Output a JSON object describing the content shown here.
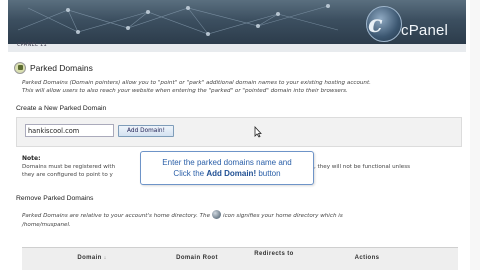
{
  "header": {
    "logo_letter": "c",
    "logo_text": "cPanel"
  },
  "breadcrumb": "CPANEL 11",
  "page": {
    "title": "Parked Domains",
    "intro_line1": "Parked Domains (Domain pointers) allow you to \"point\" or \"park\" additional domain names to your existing hosting account.",
    "intro_line2": "This will allow users to also reach your website when entering the \"parked\" or \"pointed\" domain into their browsers."
  },
  "create": {
    "heading": "Create a New Parked Domain",
    "input_value": "hankiscool.com",
    "button_label": "Add Domain!"
  },
  "note": {
    "label": "Note:",
    "line1_start": "Domains must be registered with",
    "line1_end": "dition, they will not be functional unless",
    "line2_start": "they are configured to point to y"
  },
  "callout": {
    "line1": "Enter the parked domains name and",
    "line2_prefix": "Click the ",
    "line2_bold": "Add Domain!",
    "line2_suffix": " button"
  },
  "remove": {
    "heading": "Remove Parked Domains",
    "line1_a": "Parked Domains are relative to your account's home directory. The",
    "line1_b": "icon signifies your home directory which is",
    "line2": "/home/muspanel."
  },
  "table": {
    "columns": [
      "Domain",
      "Domain Root",
      "Redirects to",
      "Actions"
    ],
    "sort_indicator": "↓"
  }
}
